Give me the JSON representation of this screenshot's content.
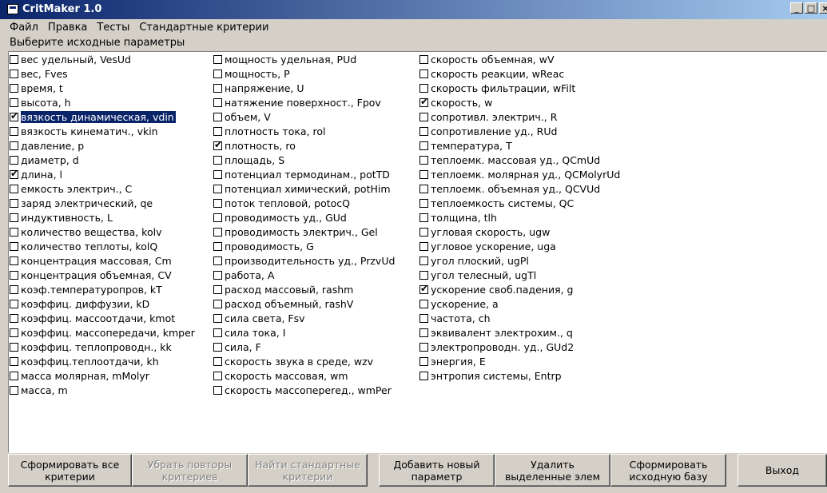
{
  "window": {
    "title": "CritMaker 1.0"
  },
  "menu": [
    "Файл",
    "Правка",
    "Тесты",
    "Стандартные критерии"
  ],
  "prompt": "Выберите исходные параметры",
  "columns": [
    [
      {
        "label": "вес удельный, VesUd",
        "checked": false
      },
      {
        "label": "вес, Fves",
        "checked": false
      },
      {
        "label": "время, t",
        "checked": false
      },
      {
        "label": "высота, h",
        "checked": false
      },
      {
        "label": "вязкость динамическая, vdin",
        "checked": true,
        "selected": true
      },
      {
        "label": "вязкость кинематич., vkin",
        "checked": false
      },
      {
        "label": "давление, p",
        "checked": false
      },
      {
        "label": "диаметр, d",
        "checked": false
      },
      {
        "label": "длина, l",
        "checked": true
      },
      {
        "label": "емкость электрич., C",
        "checked": false
      },
      {
        "label": "заряд электрический, qe",
        "checked": false
      },
      {
        "label": "индуктивность, L",
        "checked": false
      },
      {
        "label": "количество вещества, kolv",
        "checked": false
      },
      {
        "label": "количество теплоты, kolQ",
        "checked": false
      },
      {
        "label": "концентрация массовая, Cm",
        "checked": false
      },
      {
        "label": "концентрация объемная, CV",
        "checked": false
      },
      {
        "label": "коэф.температуропров, kT",
        "checked": false
      },
      {
        "label": "коэффиц. диффузии, kD",
        "checked": false
      },
      {
        "label": "коэффиц. массоотдачи, kmot",
        "checked": false
      },
      {
        "label": "коэффиц. массопередачи, kmper",
        "checked": false
      },
      {
        "label": "коэффиц. теплопроводн., kk",
        "checked": false
      },
      {
        "label": "коэффиц.теплоотдачи, kh",
        "checked": false
      },
      {
        "label": "масса молярная, mMolyr",
        "checked": false
      },
      {
        "label": "масса, m",
        "checked": false
      }
    ],
    [
      {
        "label": "мощность удельная, PUd",
        "checked": false
      },
      {
        "label": "мощность, P",
        "checked": false
      },
      {
        "label": "напряжение, U",
        "checked": false
      },
      {
        "label": "натяжение поверхност., Fpov",
        "checked": false
      },
      {
        "label": "объем, V",
        "checked": false
      },
      {
        "label": "плотность тока, rol",
        "checked": false
      },
      {
        "label": "плотность, ro",
        "checked": true
      },
      {
        "label": "площадь, S",
        "checked": false
      },
      {
        "label": "потенциал термодинам., potTD",
        "checked": false
      },
      {
        "label": "потенциал химический, potHim",
        "checked": false
      },
      {
        "label": "поток тепловой, potocQ",
        "checked": false
      },
      {
        "label": "проводимость уд., GUd",
        "checked": false
      },
      {
        "label": "проводимость электрич., Gel",
        "checked": false
      },
      {
        "label": "проводимость, G",
        "checked": false
      },
      {
        "label": "производительность уд., PrzvUd",
        "checked": false
      },
      {
        "label": "работа, A",
        "checked": false
      },
      {
        "label": "расход массовый, rashm",
        "checked": false
      },
      {
        "label": "расход объемный, rashV",
        "checked": false
      },
      {
        "label": "сила света, Fsv",
        "checked": false
      },
      {
        "label": "сила тока, I",
        "checked": false
      },
      {
        "label": "сила, F",
        "checked": false
      },
      {
        "label": "скорость звука в среде, wzv",
        "checked": false
      },
      {
        "label": "скорость массовая, wm",
        "checked": false
      },
      {
        "label": "скорость массопеperед., wmPer",
        "checked": false
      }
    ],
    [
      {
        "label": "скорость объемная, wV",
        "checked": false
      },
      {
        "label": "скорость реакции, wReac",
        "checked": false
      },
      {
        "label": "скорость фильтрации, wFilt",
        "checked": false
      },
      {
        "label": "скорость, w",
        "checked": true
      },
      {
        "label": "сопротивл. электрич., R",
        "checked": false
      },
      {
        "label": "сопротивление уд., RUd",
        "checked": false
      },
      {
        "label": "температура, T",
        "checked": false
      },
      {
        "label": "теплоемк. массовая уд., QCmUd",
        "checked": false
      },
      {
        "label": "теплоемк. молярная уд., QCMolyrUd",
        "checked": false
      },
      {
        "label": "теплоемк. объемная уд., QCVUd",
        "checked": false
      },
      {
        "label": "теплоемкость системы, QC",
        "checked": false
      },
      {
        "label": "толщина, tlh",
        "checked": false
      },
      {
        "label": "угловая скорость, ugw",
        "checked": false
      },
      {
        "label": "угловое ускорение, uga",
        "checked": false
      },
      {
        "label": "угол плоский, ugPl",
        "checked": false
      },
      {
        "label": "угол телесный, ugTl",
        "checked": false
      },
      {
        "label": "ускорение своб.падения, g",
        "checked": true
      },
      {
        "label": "ускорение, a",
        "checked": false
      },
      {
        "label": "частота, ch",
        "checked": false
      },
      {
        "label": "эквивалент электрохим., q",
        "checked": false
      },
      {
        "label": "электропроводн. уд., GUd2",
        "checked": false
      },
      {
        "label": "энергия, E",
        "checked": false
      },
      {
        "label": "энтропия системы, Entrp",
        "checked": false
      }
    ]
  ],
  "buttons": [
    {
      "label": "Сформировать все критерии",
      "disabled": false
    },
    {
      "label": "Убрать повторы критериев",
      "disabled": true
    },
    {
      "label": "Найти стандартные критерии",
      "disabled": true
    },
    {
      "label": "Добавить новый параметр",
      "disabled": false
    },
    {
      "label": "Удалить выделенные элем",
      "disabled": false
    },
    {
      "label": "Сформировать исходную базу",
      "disabled": false
    },
    {
      "label": "Выход",
      "disabled": false
    }
  ]
}
